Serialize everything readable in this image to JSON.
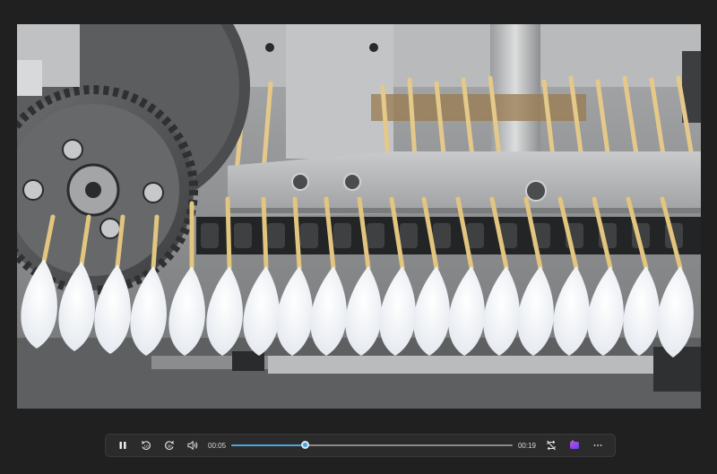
{
  "player": {
    "current_time": "00:05",
    "total_time": "00:19",
    "progress_fraction": 0.263,
    "accent_color": "#4aa3df"
  },
  "controls": [
    {
      "name": "play-pause-button",
      "icon": "pause-icon"
    },
    {
      "name": "rewind-button",
      "icon": "rewind-10-icon"
    },
    {
      "name": "forward-button",
      "icon": "forward-30-icon"
    },
    {
      "name": "volume-button",
      "icon": "speaker-icon"
    },
    {
      "name": "repeat-button",
      "icon": "repeat-off-icon"
    },
    {
      "name": "clipchamp-button",
      "icon": "clipchamp-icon"
    },
    {
      "name": "more-options-button",
      "icon": "more-horizontal-icon"
    }
  ]
}
